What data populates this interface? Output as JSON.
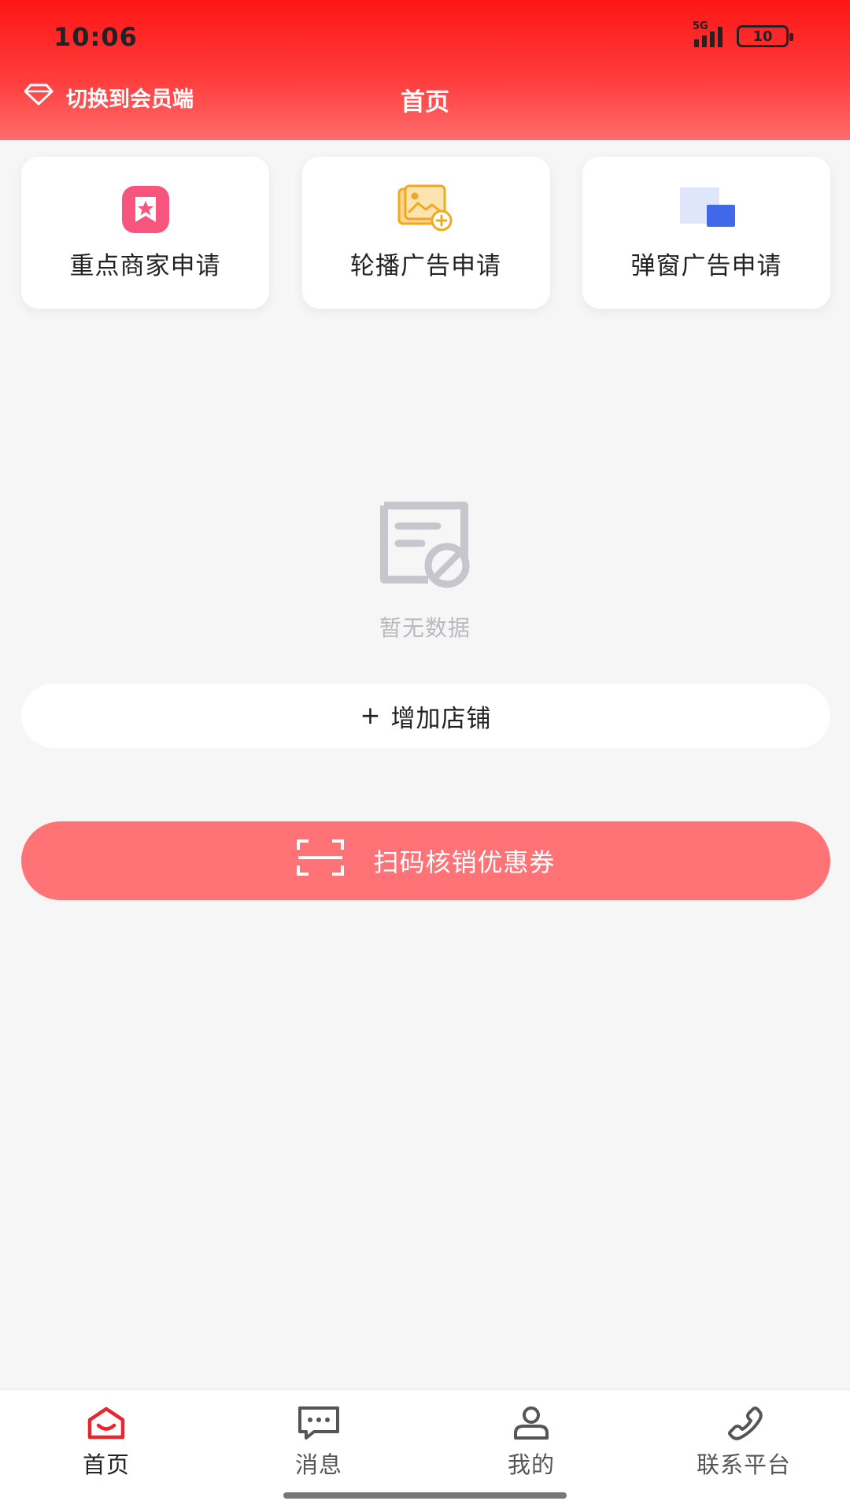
{
  "status_bar": {
    "time": "10:06",
    "network": "5G",
    "battery": "10"
  },
  "header": {
    "switch_label": "切换到会员端",
    "title": "首页"
  },
  "cards": [
    {
      "label": "重点商家申请",
      "icon": "star-badge-icon"
    },
    {
      "label": "轮播广告申请",
      "icon": "image-add-icon"
    },
    {
      "label": "弹窗广告申请",
      "icon": "popup-window-icon"
    }
  ],
  "empty_state": {
    "text": "暂无数据",
    "icon": "no-data-icon"
  },
  "add_shop": {
    "plus": "+",
    "label": "增加店铺"
  },
  "scan": {
    "label": "扫码核销优惠券",
    "icon": "scan-frame-icon"
  },
  "bottom_nav": [
    {
      "label": "首页",
      "icon": "home-icon",
      "active": true
    },
    {
      "label": "消息",
      "icon": "message-icon",
      "active": false
    },
    {
      "label": "我的",
      "icon": "user-icon",
      "active": false
    },
    {
      "label": "联系平台",
      "icon": "phone-icon",
      "active": false
    }
  ],
  "colors": {
    "primary": "#fe1616",
    "scan_button": "#ff7376",
    "active_icon": "#e8262b",
    "empty_gray": "#b9b9be"
  }
}
